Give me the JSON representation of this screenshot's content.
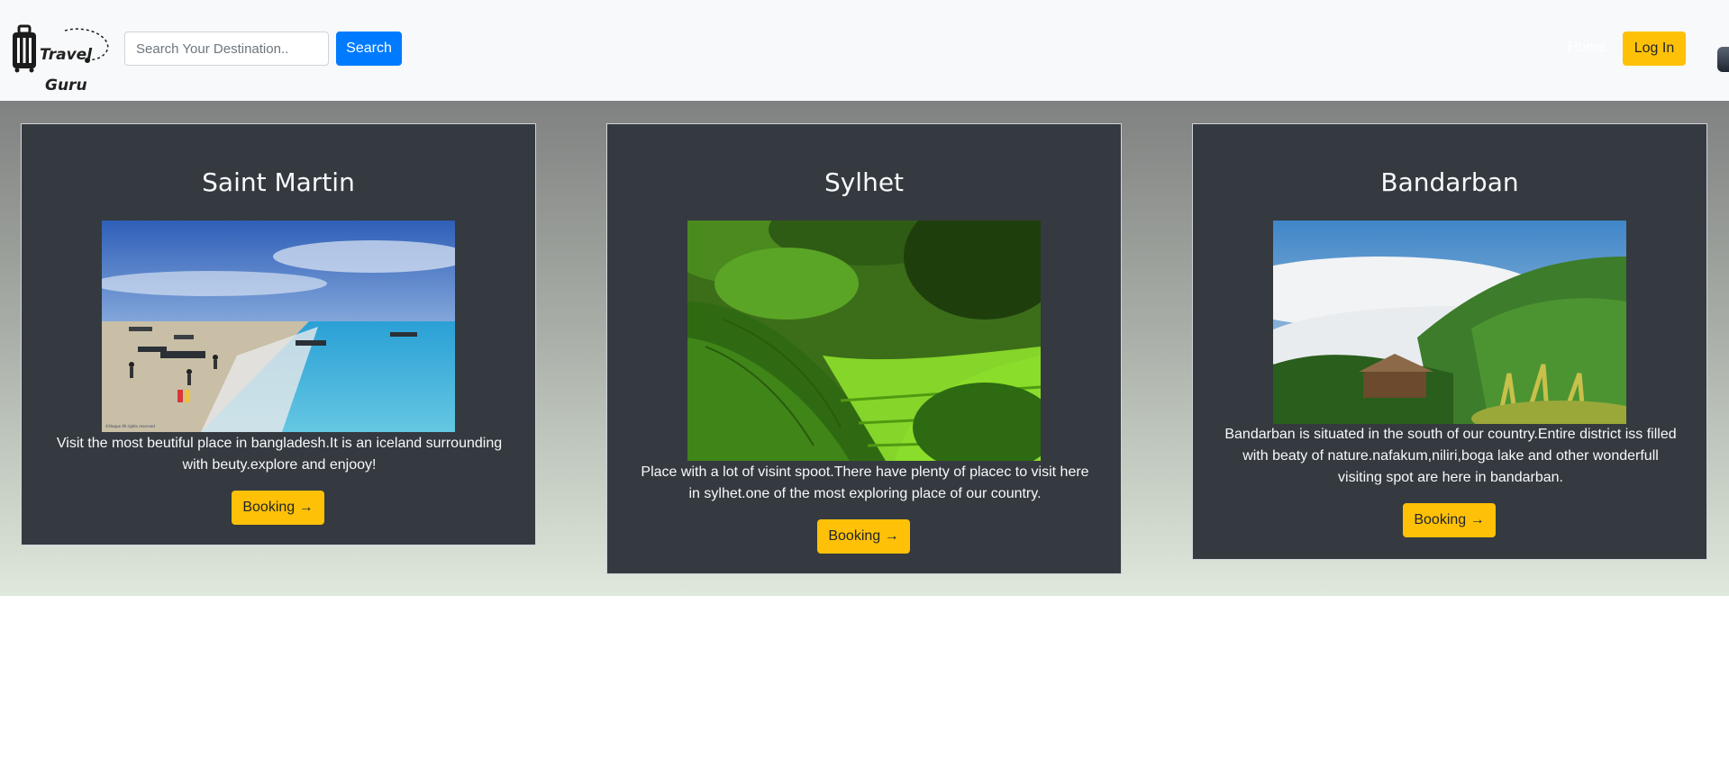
{
  "navbar": {
    "logo_line1": "Travel",
    "logo_line2": "Guru",
    "search_placeholder": "Search Your Destination..",
    "search_label": "Search",
    "home_label": "Home",
    "login_label": "Log In"
  },
  "cards": [
    {
      "title": "Saint Martin",
      "description": "Visit the most beutiful place in bangladesh.It is an iceland surrounding with beuty.explore and enjooy!",
      "button_label": "Booking →",
      "image_caption": "©Haque All rights reserved"
    },
    {
      "title": "Sylhet",
      "description": "Place with a lot of visint spoot.There have plenty of placec to visit here in sylhet.one of the most exploring place of our country.",
      "button_label": "Booking →"
    },
    {
      "title": "Bandarban",
      "description": "Bandarban is situated in the south of our country.Entire district iss filled with beaty of nature.nafakum,niliri,boga lake and other wonderfull visiting spot are here in bandarban.",
      "button_label": "Booking →"
    }
  ],
  "colors": {
    "navbar_bg": "#f8f9fa",
    "search_button": "#007bff",
    "accent_yellow": "#ffc107",
    "card_bg": "#343a40"
  }
}
